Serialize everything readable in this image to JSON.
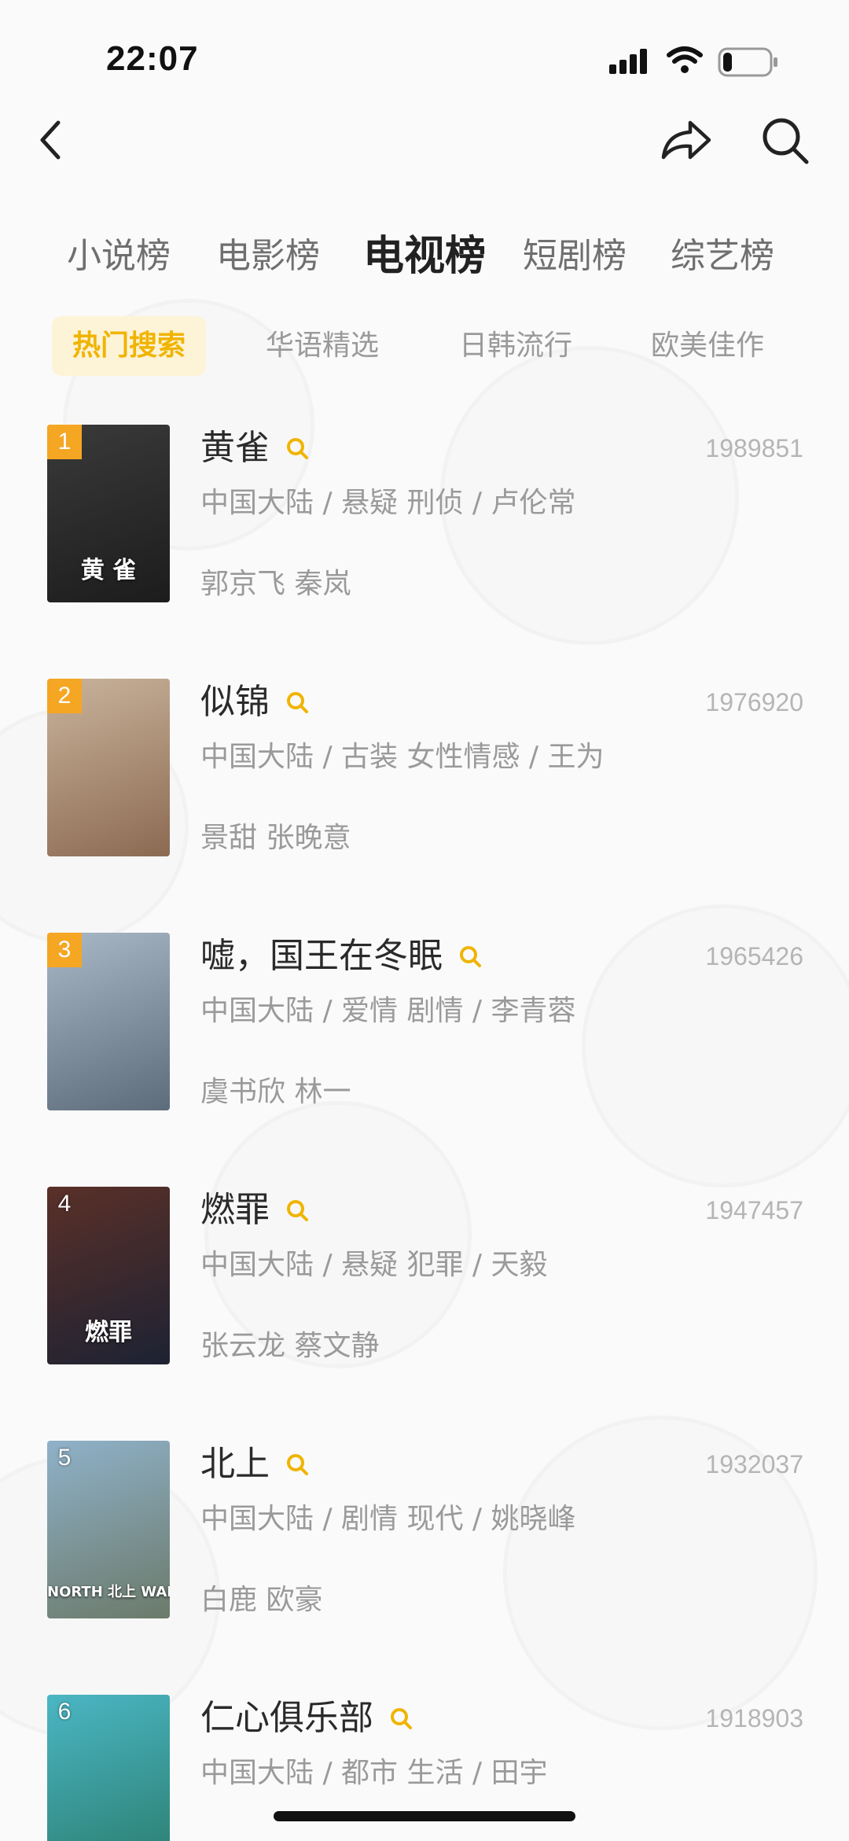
{
  "status_bar": {
    "time": "22:07",
    "icons": [
      "signal-icon",
      "wifi-icon",
      "battery-icon"
    ],
    "battery_level": 0.2
  },
  "nav": {
    "back_icon": "chevron-left-icon",
    "share_icon": "share-icon",
    "search_icon": "search-icon"
  },
  "main_tabs": [
    {
      "label": "小说榜",
      "active": false
    },
    {
      "label": "电影榜",
      "active": false
    },
    {
      "label": "电视榜",
      "active": true
    },
    {
      "label": "短剧榜",
      "active": false
    },
    {
      "label": "综艺榜",
      "active": false
    }
  ],
  "sub_tabs": [
    {
      "label": "热门搜索",
      "active": true
    },
    {
      "label": "华语精选",
      "active": false
    },
    {
      "label": "日韩流行",
      "active": false
    },
    {
      "label": "欧美佳作",
      "active": false
    }
  ],
  "list": [
    {
      "rank": "1",
      "title": "黄雀",
      "score": "1989851",
      "meta": "中国大陆 / 悬疑 刑侦 / 卢伦常",
      "cast": "郭京飞 秦岚",
      "poster_caption": "黄 雀",
      "poster_colors": [
        "#3a3a3a",
        "#1c1c1c"
      ]
    },
    {
      "rank": "2",
      "title": "似锦",
      "score": "1976920",
      "meta": "中国大陆 / 古装 女性情感 / 王为",
      "cast": "景甜 张晚意",
      "poster_caption": "",
      "poster_colors": [
        "#c9b39b",
        "#8c6a52"
      ]
    },
    {
      "rank": "3",
      "title": "嘘，国王在冬眠",
      "score": "1965426",
      "meta": "中国大陆 / 爱情 剧情 / 李青蓉",
      "cast": "虞书欣 林一",
      "poster_caption": "",
      "poster_colors": [
        "#a9b8c6",
        "#5d6c7b"
      ]
    },
    {
      "rank": "4",
      "title": "燃罪",
      "score": "1947457",
      "meta": "中国大陆 / 悬疑 犯罪 / 天毅",
      "cast": "张云龙 蔡文静",
      "poster_caption": "燃罪",
      "poster_colors": [
        "#5a3028",
        "#1d2233"
      ]
    },
    {
      "rank": "5",
      "title": "北上",
      "score": "1932037",
      "meta": "中国大陆 / 剧情 现代 / 姚晓峰",
      "cast": "白鹿 欧豪",
      "poster_caption": "NORTH 北上 WARD",
      "poster_colors": [
        "#8fb1c9",
        "#6b7a6a"
      ]
    },
    {
      "rank": "6",
      "title": "仁心俱乐部",
      "score": "1918903",
      "meta": "中国大陆 / 都市 生活 / 田宇",
      "cast": "",
      "poster_caption": "",
      "poster_colors": [
        "#4bb6c4",
        "#2a7d6e"
      ]
    }
  ],
  "colors": {
    "accent": "#f0b400",
    "rank_badge": "#f5a623",
    "muted_text": "#9a9a9a"
  }
}
